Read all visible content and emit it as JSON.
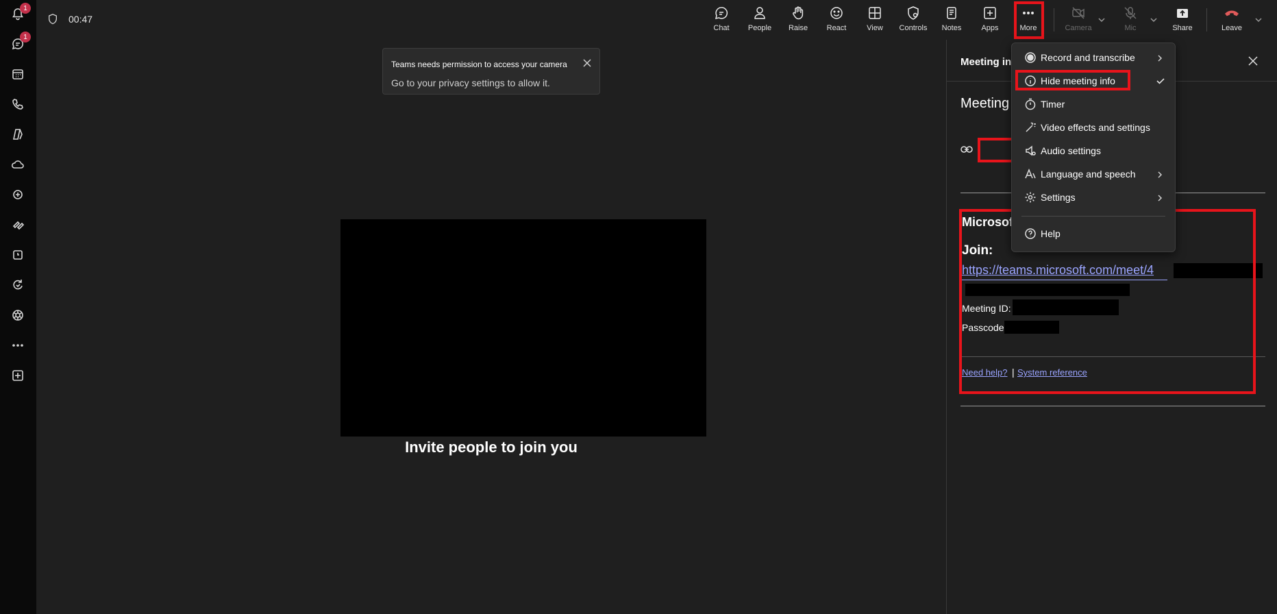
{
  "rail": {
    "items": [
      {
        "icon": "bell-icon",
        "name": "activity",
        "badge": "1"
      },
      {
        "icon": "chat-icon",
        "name": "chat",
        "badge": "1"
      },
      {
        "icon": "calendar-icon",
        "name": "calendar"
      },
      {
        "icon": "phone-icon",
        "name": "calls"
      },
      {
        "icon": "copilot-icon",
        "name": "copilot"
      },
      {
        "icon": "cloud-icon",
        "name": "onedrive"
      },
      {
        "icon": "exchange-icon",
        "name": "exchange"
      },
      {
        "icon": "shortcuts-icon",
        "name": "shortcuts"
      },
      {
        "icon": "clock-icon",
        "name": "shifts"
      },
      {
        "icon": "refresh-icon",
        "name": "updates"
      },
      {
        "icon": "hex-icon",
        "name": "apps-hex"
      },
      {
        "icon": "more-icon",
        "name": "more-apps"
      },
      {
        "icon": "add-icon",
        "name": "add-app"
      }
    ]
  },
  "topbar": {
    "timer": "00:47",
    "buttons": {
      "chat": "Chat",
      "people": "People",
      "raise": "Raise",
      "react": "React",
      "view": "View",
      "controls": "Controls",
      "notes": "Notes",
      "apps": "Apps",
      "more": "More",
      "camera": "Camera",
      "mic": "Mic",
      "share": "Share",
      "leave": "Leave"
    }
  },
  "toast": {
    "title": "Teams needs permission to access your camera",
    "body": "Go to your privacy settings to allow it."
  },
  "stage": {
    "invite": "Invite people to join you"
  },
  "panel": {
    "header": "Meeting in",
    "meeting_title": "Meeting",
    "org": "Microsoft",
    "join_label": "Join:",
    "join_url": "https://teams.microsoft.com/meet/4",
    "meeting_id_label": "Meeting ID:",
    "passcode_label": "Passcode",
    "help_link": "Need help?",
    "separator": "|",
    "system_link": "System reference"
  },
  "menu": {
    "items": [
      {
        "label": "Record and transcribe",
        "icon": "record-icon",
        "submenu": true
      },
      {
        "label": "Hide meeting info",
        "icon": "info-icon",
        "checked": true
      },
      {
        "label": "Timer",
        "icon": "timer-icon"
      },
      {
        "label": "Video effects and settings",
        "icon": "wand-icon"
      },
      {
        "label": "Audio settings",
        "icon": "speaker-icon"
      },
      {
        "label": "Language and speech",
        "icon": "language-icon",
        "submenu": true
      },
      {
        "label": "Settings",
        "icon": "gear-icon",
        "submenu": true
      },
      {
        "label": "Help",
        "icon": "help-icon"
      }
    ]
  },
  "colors": {
    "highlight": "#e8141b",
    "link": "#9aa4ff",
    "badge": "#c4314b",
    "leave": "#e05a5a"
  }
}
